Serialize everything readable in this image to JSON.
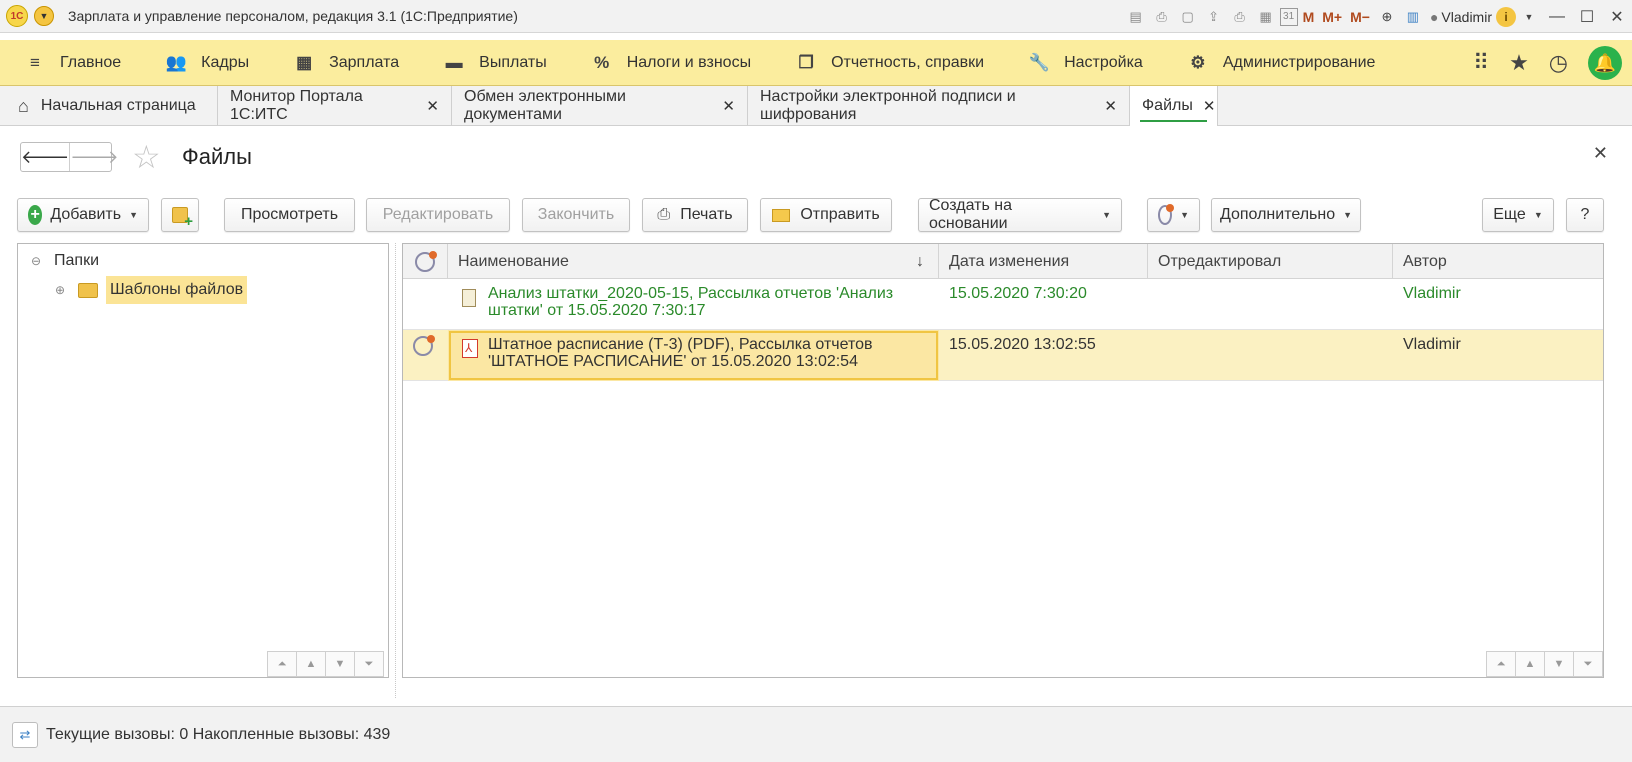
{
  "window": {
    "logo": "1С",
    "title": "Зарплата и управление персоналом, редакция 3.1  (1С:Предприятие)",
    "user": "Vladimir",
    "m_labels": [
      "M",
      "M+",
      "M−"
    ],
    "icons": [
      "save-icon",
      "print-icon",
      "preview-icon",
      "upload-icon",
      "printer-icon",
      "calculator-icon",
      "calendar-icon"
    ],
    "calendar_day": "31"
  },
  "main_menu": {
    "items": [
      {
        "label": "Главное",
        "icon": "hamburger-icon"
      },
      {
        "label": "Кадры",
        "icon": "people-icon"
      },
      {
        "label": "Зарплата",
        "icon": "calculator-icon"
      },
      {
        "label": "Выплаты",
        "icon": "wallet-icon"
      },
      {
        "label": "Налоги и взносы",
        "icon": "percent-icon"
      },
      {
        "label": "Отчетность, справки",
        "icon": "documents-icon"
      },
      {
        "label": "Настройка",
        "icon": "wrench-icon"
      },
      {
        "label": "Администрирование",
        "icon": "gear-icon"
      }
    ]
  },
  "tabs": [
    {
      "label": "Начальная страница",
      "closable": false
    },
    {
      "label": "Монитор Портала 1С:ИТС",
      "closable": true
    },
    {
      "label": "Обмен электронными документами",
      "closable": true
    },
    {
      "label": "Настройки электронной подписи и шифрования",
      "closable": true
    },
    {
      "label": "Файлы",
      "closable": true,
      "active": true
    }
  ],
  "form": {
    "title": "Файлы"
  },
  "toolbar": {
    "add_label": "Добавить",
    "view_label": "Просмотреть",
    "edit_label": "Редактировать",
    "finish_label": "Закончить",
    "print_label": "Печать",
    "send_label": "Отправить",
    "create_based_label": "Создать на основании",
    "additional_label": "Дополнительно",
    "more_label": "Еще",
    "help_label": "?"
  },
  "folders": {
    "root": "Папки",
    "children": [
      "Шаблоны файлов"
    ]
  },
  "files_table": {
    "columns": [
      "Наименование",
      "Дата изменения",
      "Отредактировал",
      "Автор"
    ],
    "rows": [
      {
        "name": "Анализ штатки_2020-05-15, Рассылка отчетов 'Анализ штатки' от 15.05.2020 7:30:17",
        "date": "15.05.2020 7:30:20",
        "editor": "",
        "author": "Vladimir"
      },
      {
        "name": "Штатное расписание (Т-3) (PDF), Рассылка отчетов 'ШТАТНОЕ РАСПИСАНИЕ' от 15.05.2020 13:02:54",
        "date": "15.05.2020 13:02:55",
        "editor": "",
        "author": "Vladimir"
      }
    ]
  },
  "status": {
    "text": "Текущие вызовы: 0   Накопленные вызовы: 439"
  },
  "colors": {
    "menu_bg": "#fbed9e",
    "accent_green": "#2f9e44",
    "selection": "#fbf1c2",
    "edited_text": "#2a8a2a"
  }
}
